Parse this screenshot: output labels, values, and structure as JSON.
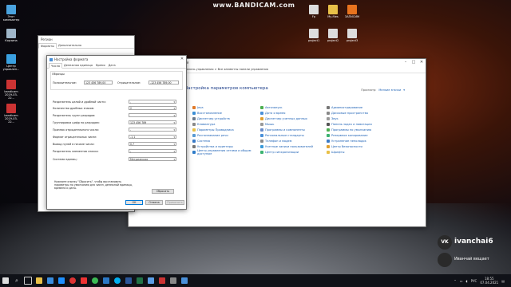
{
  "watermark": "www.BANDICAM.com",
  "desktop_icons_left": [
    {
      "label": "Этот компьютер",
      "color": "#4aa3df"
    },
    {
      "label": "Корзина",
      "color": "#9fb6c9"
    },
    {
      "label": "Центр управлен...",
      "color": "#3aa0e0"
    },
    {
      "label": "bandicam 2019-03-22...",
      "color": "#c33"
    },
    {
      "label": "bandicam 2019-03-22...",
      "color": "#c33"
    }
  ],
  "desktop_icons_right": [
    {
      "label": "Fp",
      "color": "#ddd"
    },
    {
      "label": "My-files",
      "color": "#e8c048"
    },
    {
      "label": "ЗАПИСИМ",
      "color": "#e8731e"
    },
    {
      "label": "project1",
      "color": "#ddd"
    },
    {
      "label": "project2",
      "color": "#ddd"
    },
    {
      "label": "project3",
      "color": "#ddd"
    }
  ],
  "region_window": {
    "title": "Регион",
    "tabs": [
      "Форматы",
      "Дополнительно"
    ]
  },
  "format_window": {
    "title": "Настройка формата",
    "tabs": [
      "Числа",
      "Денежная единица",
      "Время",
      "Дата"
    ],
    "samples_label": "Образцы",
    "positive_label": "Положительное:",
    "positive_value": "123 456 789,00",
    "negative_label": "Отрицательное:",
    "negative_value": "-123 456 789,00",
    "rows": [
      {
        "label": "Разделитель целой и дробной части:",
        "value": ","
      },
      {
        "label": "Количество дробных знаков:",
        "value": "2"
      },
      {
        "label": "Разделитель групп разрядов:",
        "value": ""
      },
      {
        "label": "Группировка цифр по разрядам:",
        "value": "123 456 789"
      },
      {
        "label": "Признак отрицательного числа:",
        "value": "-"
      },
      {
        "label": "Формат отрицательных чисел:",
        "value": "-1,1"
      },
      {
        "label": "Вывод нулей в начале числа:",
        "value": "0,7"
      },
      {
        "label": "Разделитель элементов списка:",
        "value": ";"
      },
      {
        "label": "Система единиц:",
        "value": "Метрическая"
      }
    ],
    "note": "Нажмите кнопку \"Сбросить\", чтобы восстановить параметры по умолчанию для чисел, денежной единицы, времени и даты.",
    "reset_label": "Сбросить",
    "ok_label": "ОК",
    "cancel_label": "Отмена",
    "apply_label": "Применить"
  },
  "cp_window": {
    "title": "Все элементы панели управления",
    "breadcrumb": "Панель управления  >  Все элементы панели управления",
    "heading": "Настройка параметров компьютера",
    "view_label": "Просмотр:",
    "view_value": "Мелкие значки",
    "col1": [
      "Java",
      "Восстановление",
      "Диспетчер устройств",
      "Клавиатура",
      "Параметры Проводника",
      "Распознавание речи",
      "Система",
      "Устройства и принтеры",
      "Центр управления сетями и общим доступом"
    ],
    "col2": [
      "Автозапуск",
      "Дата и время",
      "Диспетчер учетных данных",
      "Мышь",
      "Программы и компоненты",
      "Региональные стандарты",
      "Телефон и модем",
      "Учетные записи пользователей",
      "Центр синхронизации"
    ],
    "col3": [
      "Администрирование",
      "Дисковые пространства",
      "Звук",
      "Панель задач и навигация",
      "Программы по умолчанию",
      "Резервное копирование",
      "Устранение неполадок",
      "Центр безопасности",
      "Шрифты"
    ]
  },
  "overlay": {
    "name": "ivanchai6",
    "subtitle": "Иванчай вещает"
  },
  "tray": {
    "lang": "РУС",
    "time": "18:55",
    "date": "07.04.2021"
  }
}
